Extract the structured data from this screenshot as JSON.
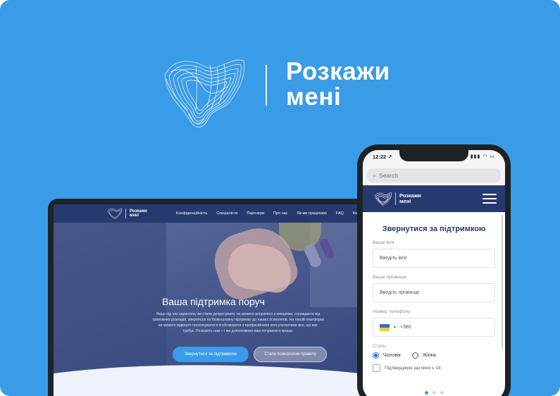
{
  "brand": {
    "name_line1": "Розкажи",
    "name_line2": "мені"
  },
  "laptop_site": {
    "brand_line1": "Розкажи",
    "brand_line2": "мені",
    "nav": [
      "Конфіденційність",
      "Спеціалісти",
      "Партнери",
      "Про нас",
      "Як ми працюємо",
      "FAQ",
      "Контакти"
    ],
    "hero_title": "Ваша підтримка поруч",
    "hero_text": "Якщо під час карантину ви стали депресувати, не можете впоратися з емоціями, страждаєте від тривожних розладів, зверніться по безкоштовну підтримку до наших психологів. На нашій платформі ви можете відверто поспілкуватися й обговорити з професійними консультантами все, що вас турбує. Розкажіть нам – і ми допоможемо вам почуватися краще.",
    "btn_support": "Звернутися за підтримкою",
    "btn_psychologist": "Стати психологом проекту"
  },
  "phone": {
    "status_time": "12:22 ↗",
    "status_icons": "▮▮▮ ◠ ▭",
    "search_placeholder": "Search",
    "brand_line1": "Розкажи",
    "brand_line2": "мені",
    "form": {
      "title": "Звернутися за підтримкою",
      "name_label": "Ваше ім'я",
      "name_placeholder": "Введіть ім'я",
      "surname_label": "Ваше прізвище",
      "surname_placeholder": "Введіть прізвище",
      "phone_label": "Номер телефону",
      "phone_code": "+380",
      "gender_label": "Стать",
      "gender_options": [
        "Чоловік",
        "Жінка"
      ],
      "gender_selected": "Чоловік",
      "age_confirm": "Підтверджую що мені є 18",
      "pagination_total": 3,
      "pagination_active": 1
    }
  },
  "colors": {
    "background": "#3a9be6",
    "navy": "#263a70",
    "accent": "#3a9be6"
  }
}
